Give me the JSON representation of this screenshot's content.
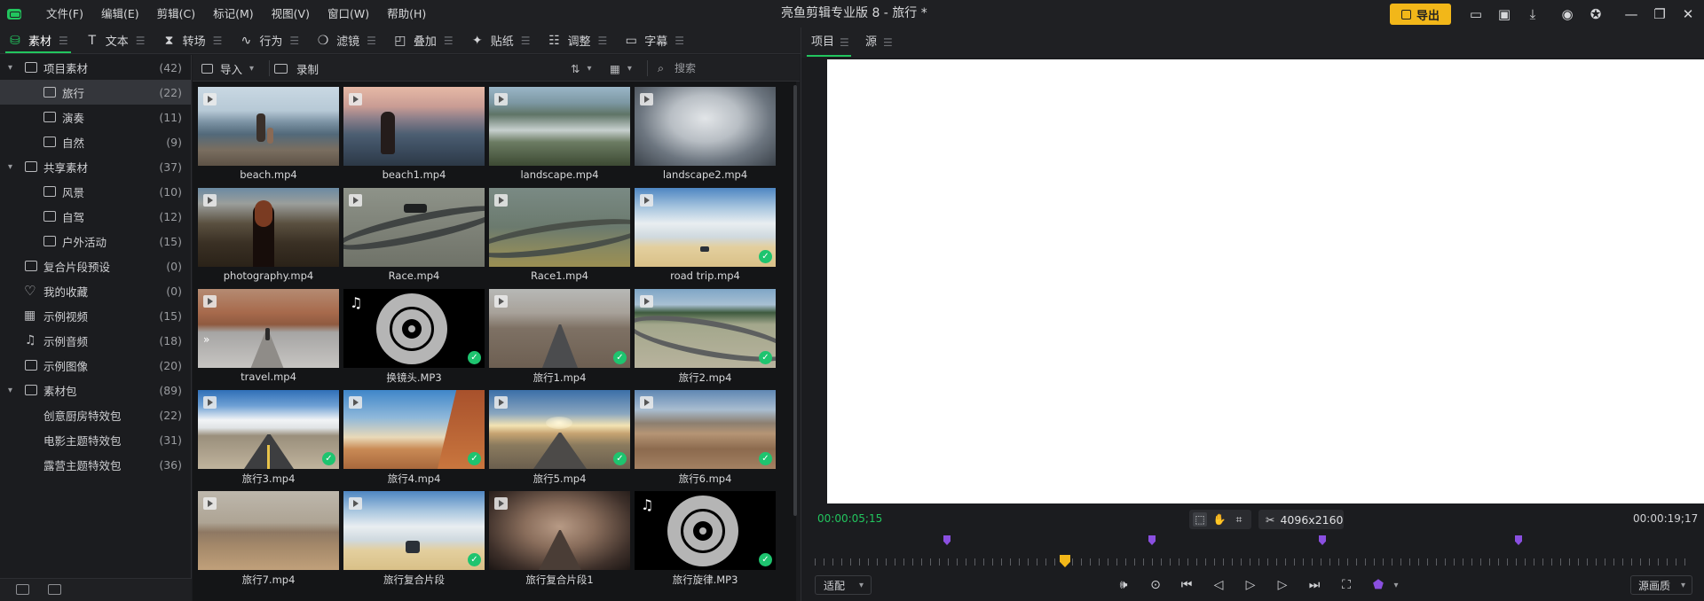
{
  "window": {
    "title": "亮鱼剪辑专业版 8 - 旅行 *",
    "export_label": "导出",
    "accent": "#22c55e",
    "export_color": "#f2b719"
  },
  "menu": [
    "文件(F)",
    "编辑(E)",
    "剪辑(C)",
    "标记(M)",
    "视图(V)",
    "窗口(W)",
    "帮助(H)"
  ],
  "tabs": [
    "素材",
    "文本",
    "转场",
    "行为",
    "滤镜",
    "叠加",
    "贴纸",
    "调整",
    "字幕"
  ],
  "sidebar": [
    {
      "label": "项目素材",
      "count": "(42)"
    },
    {
      "label": "旅行",
      "count": "(22)"
    },
    {
      "label": "演奏",
      "count": "(11)"
    },
    {
      "label": "自然",
      "count": "(9)"
    },
    {
      "label": "共享素材",
      "count": "(37)"
    },
    {
      "label": "风景",
      "count": "(10)"
    },
    {
      "label": "自驾",
      "count": "(12)"
    },
    {
      "label": "户外活动",
      "count": "(15)"
    },
    {
      "label": "复合片段预设",
      "count": "(0)"
    },
    {
      "label": "我的收藏",
      "count": "(0)"
    },
    {
      "label": "示例视频",
      "count": "(15)"
    },
    {
      "label": "示例音频",
      "count": "(18)"
    },
    {
      "label": "示例图像",
      "count": "(20)"
    },
    {
      "label": "素材包",
      "count": "(89)"
    },
    {
      "label": "创意厨房特效包",
      "count": "(22)"
    },
    {
      "label": "电影主题特效包",
      "count": "(31)"
    },
    {
      "label": "露营主题特效包",
      "count": "(36)"
    }
  ],
  "toolbar": {
    "import_label": "导入",
    "record_label": "录制",
    "search_placeholder": "搜索"
  },
  "media": [
    {
      "name": "beach.mp4"
    },
    {
      "name": "beach1.mp4"
    },
    {
      "name": "landscape.mp4"
    },
    {
      "name": "landscape2.mp4"
    },
    {
      "name": "photography.mp4"
    },
    {
      "name": "Race.mp4"
    },
    {
      "name": "Race1.mp4"
    },
    {
      "name": "road trip.mp4"
    },
    {
      "name": "travel.mp4"
    },
    {
      "name": "换镜头.MP3"
    },
    {
      "name": "旅行1.mp4"
    },
    {
      "name": "旅行2.mp4"
    },
    {
      "name": "旅行3.mp4"
    },
    {
      "name": "旅行4.mp4"
    },
    {
      "name": "旅行5.mp4"
    },
    {
      "name": "旅行6.mp4"
    },
    {
      "name": "旅行7.mp4"
    },
    {
      "name": "旅行复合片段"
    },
    {
      "name": "旅行复合片段1"
    },
    {
      "name": "旅行旋律.MP3"
    }
  ],
  "preview": {
    "tab_project": "项目",
    "tab_source": "源",
    "timecode_current": "00:00:05;15",
    "timecode_total": "00:00:19;17",
    "resolution": "4096x2160",
    "fit_label": "适配",
    "quality_label": "源画质"
  }
}
